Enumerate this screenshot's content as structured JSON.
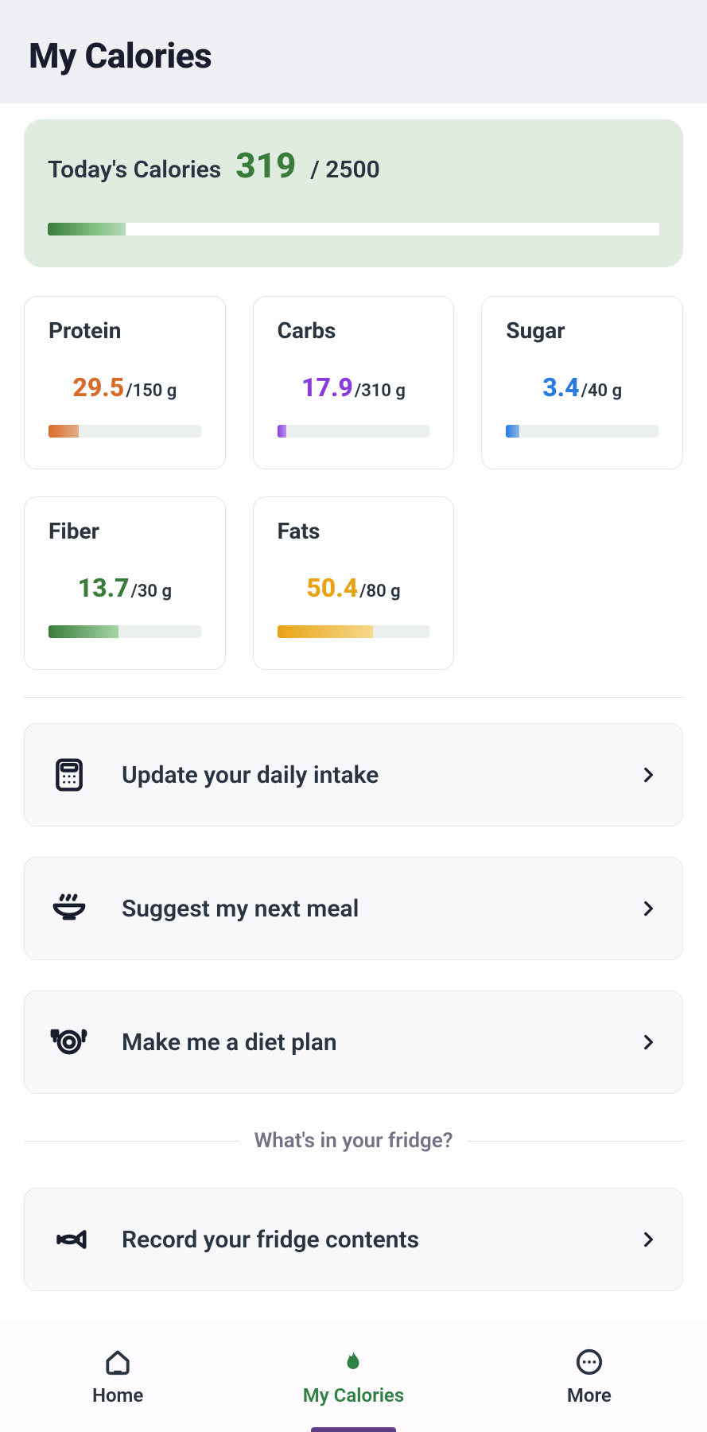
{
  "header": {
    "title": "My Calories"
  },
  "calories": {
    "label": "Today's Calories",
    "current": 319,
    "target": 2500,
    "fill_pct": 12.76
  },
  "nutrients": [
    {
      "name": "Protein",
      "current": 29.5,
      "target": 150,
      "unit": "g",
      "color": "#d96b2a",
      "fill_pct": 19.7
    },
    {
      "name": "Carbs",
      "current": 17.9,
      "target": 310,
      "unit": "g",
      "color": "#8a3be0",
      "fill_pct": 5.8
    },
    {
      "name": "Sugar",
      "current": 3.4,
      "target": 40,
      "unit": "g",
      "color": "#2a7be0",
      "fill_pct": 8.5
    },
    {
      "name": "Fiber",
      "current": 13.7,
      "target": 30,
      "unit": "g",
      "color": "#3a7c3a",
      "fill_pct": 45.7,
      "grad_to": "#a6d6a6"
    },
    {
      "name": "Fats",
      "current": 50.4,
      "target": 80,
      "unit": "g",
      "color": "#e8a416",
      "fill_pct": 63.0,
      "grad_to": "#f6d98c"
    }
  ],
  "actions": [
    {
      "id": "update-intake",
      "label": "Update your daily intake",
      "icon": "calculator"
    },
    {
      "id": "suggest-meal",
      "label": "Suggest my next meal",
      "icon": "bowl"
    },
    {
      "id": "diet-plan",
      "label": "Make me a diet plan",
      "icon": "plate"
    }
  ],
  "fridge": {
    "separator": "What's in your fridge?",
    "action": {
      "id": "record-fridge",
      "label": "Record your fridge contents",
      "icon": "fish"
    }
  },
  "tabs": [
    {
      "id": "home",
      "label": "Home",
      "icon": "home",
      "active": false
    },
    {
      "id": "my-calories",
      "label": "My Calories",
      "icon": "flame",
      "active": true
    },
    {
      "id": "more",
      "label": "More",
      "icon": "dots",
      "active": false
    }
  ]
}
